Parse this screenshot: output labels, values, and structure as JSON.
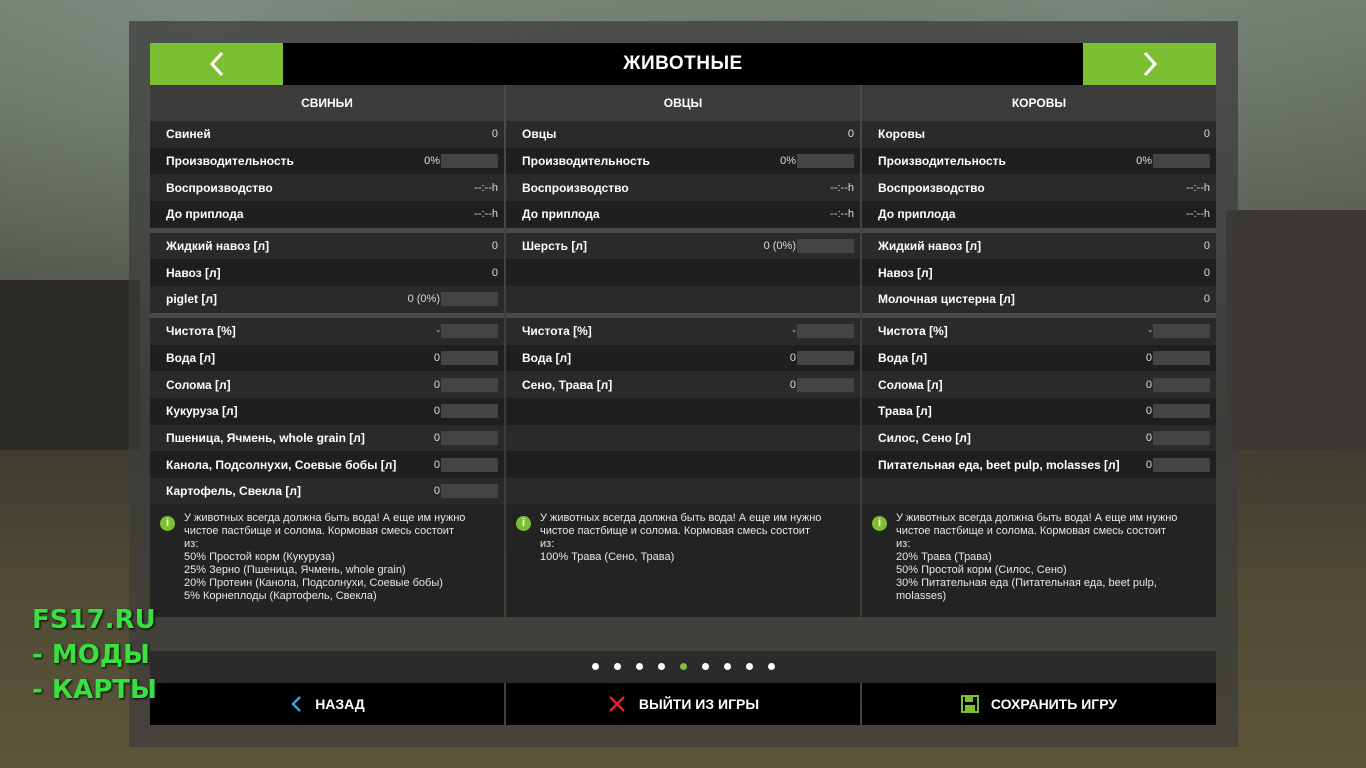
{
  "title": "ЖИВОТНЫЕ",
  "nav": {
    "prev": "‹",
    "next": "›"
  },
  "columns": [
    {
      "header": "СВИНЬИ",
      "rows": [
        {
          "label": "Свиней",
          "value": "0",
          "bar": false
        },
        {
          "label": "Производительность",
          "value": "0%",
          "bar": true
        },
        {
          "label": "Воспроизводство",
          "value": "--:--h",
          "bar": false
        },
        {
          "label": "До приплода",
          "value": "--:--h",
          "bar": false
        },
        {
          "gap": true
        },
        {
          "label": "Жидкий навоз [л]",
          "value": "0",
          "bar": false
        },
        {
          "label": "Навоз [л]",
          "value": "0",
          "bar": false
        },
        {
          "label": "piglet [л]",
          "value": "0 (0%)",
          "bar": true
        },
        {
          "gap": true
        },
        {
          "label": "Чистота [%]",
          "value": "-",
          "bar": true
        },
        {
          "label": "Вода [л]",
          "value": "0",
          "bar": true
        },
        {
          "label": "Солома [л]",
          "value": "0",
          "bar": true
        },
        {
          "label": "Кукуруза [л]",
          "value": "0",
          "bar": true
        },
        {
          "label": "Пшеница, Ячмень, whole grain [л]",
          "value": "0",
          "bar": true
        },
        {
          "label": "Канола, Подсолнухи, Соевые бобы [л]",
          "value": "0",
          "bar": true
        },
        {
          "label": "Картофель, Свекла [л]",
          "value": "0",
          "bar": true
        }
      ],
      "info": "У животных всегда должна быть вода! А еще им нужно\nчистое пастбище и солома. Кормовая смесь состоит\nиз:\n50% Простой корм (Кукуруза)\n25% Зерно (Пшеница, Ячмень, whole grain)\n20% Протеин (Канола, Подсолнухи, Соевые бобы)\n5% Корнеплоды (Картофель, Свекла)"
    },
    {
      "header": "ОВЦЫ",
      "rows": [
        {
          "label": "Овцы",
          "value": "0",
          "bar": false
        },
        {
          "label": "Производительность",
          "value": "0%",
          "bar": true
        },
        {
          "label": "Воспроизводство",
          "value": "--:--h",
          "bar": false
        },
        {
          "label": "До приплода",
          "value": "--:--h",
          "bar": false
        },
        {
          "gap": true
        },
        {
          "label": "Шерсть [л]",
          "value": "0 (0%)",
          "bar": true
        },
        {
          "label": "",
          "value": "",
          "bar": false
        },
        {
          "label": "",
          "value": "",
          "bar": false
        },
        {
          "gap": true
        },
        {
          "label": "Чистота [%]",
          "value": "-",
          "bar": true
        },
        {
          "label": "Вода [л]",
          "value": "0",
          "bar": true
        },
        {
          "label": "Сено, Трава [л]",
          "value": "0",
          "bar": true
        },
        {
          "label": "",
          "value": "",
          "bar": false
        },
        {
          "label": "",
          "value": "",
          "bar": false
        },
        {
          "label": "",
          "value": "",
          "bar": false
        },
        {
          "label": "",
          "value": "",
          "bar": false
        }
      ],
      "info": "У животных всегда должна быть вода! А еще им нужно\nчистое пастбище и солома. Кормовая смесь состоит\nиз:\n100% Трава (Сено, Трава)"
    },
    {
      "header": "КОРОВЫ",
      "rows": [
        {
          "label": "Коровы",
          "value": "0",
          "bar": false
        },
        {
          "label": "Производительность",
          "value": "0%",
          "bar": true
        },
        {
          "label": "Воспроизводство",
          "value": "--:--h",
          "bar": false
        },
        {
          "label": "До приплода",
          "value": "--:--h",
          "bar": false
        },
        {
          "gap": true
        },
        {
          "label": "Жидкий навоз [л]",
          "value": "0",
          "bar": false
        },
        {
          "label": "Навоз [л]",
          "value": "0",
          "bar": false
        },
        {
          "label": "Молочная цистерна [л]",
          "value": "0",
          "bar": false
        },
        {
          "gap": true
        },
        {
          "label": "Чистота [%]",
          "value": "-",
          "bar": true
        },
        {
          "label": "Вода [л]",
          "value": "0",
          "bar": true
        },
        {
          "label": "Солома [л]",
          "value": "0",
          "bar": true
        },
        {
          "label": "Трава [л]",
          "value": "0",
          "bar": true
        },
        {
          "label": "Силос, Сено [л]",
          "value": "0",
          "bar": true
        },
        {
          "label": "Питательная еда, beet pulp, molasses [л]",
          "value": "0",
          "bar": true
        },
        {
          "label": "",
          "value": "",
          "bar": false
        }
      ],
      "info": "У животных всегда должна быть вода! А еще им нужно\nчистое пастбище и солома. Кормовая смесь состоит\nиз:\n20% Трава (Трава)\n50% Простой корм (Силос, Сено)\n30% Питательная еда (Питательная еда, beet pulp,\nmolasses)"
    }
  ],
  "info_icon": "i",
  "pager": {
    "count": 9,
    "active": 4
  },
  "footer": {
    "back": "НАЗАД",
    "quit": "ВЫЙТИ ИЗ ИГРЫ",
    "save": "СОХРАНИТЬ ИГРУ"
  },
  "watermark": [
    "FS17.RU",
    "- МОДЫ",
    "- КАРТЫ"
  ],
  "colors": {
    "accent": "#7dbf32",
    "watermark": "#38e040",
    "quit_icon": "#e0202a",
    "back_icon": "#3aa0e0"
  }
}
